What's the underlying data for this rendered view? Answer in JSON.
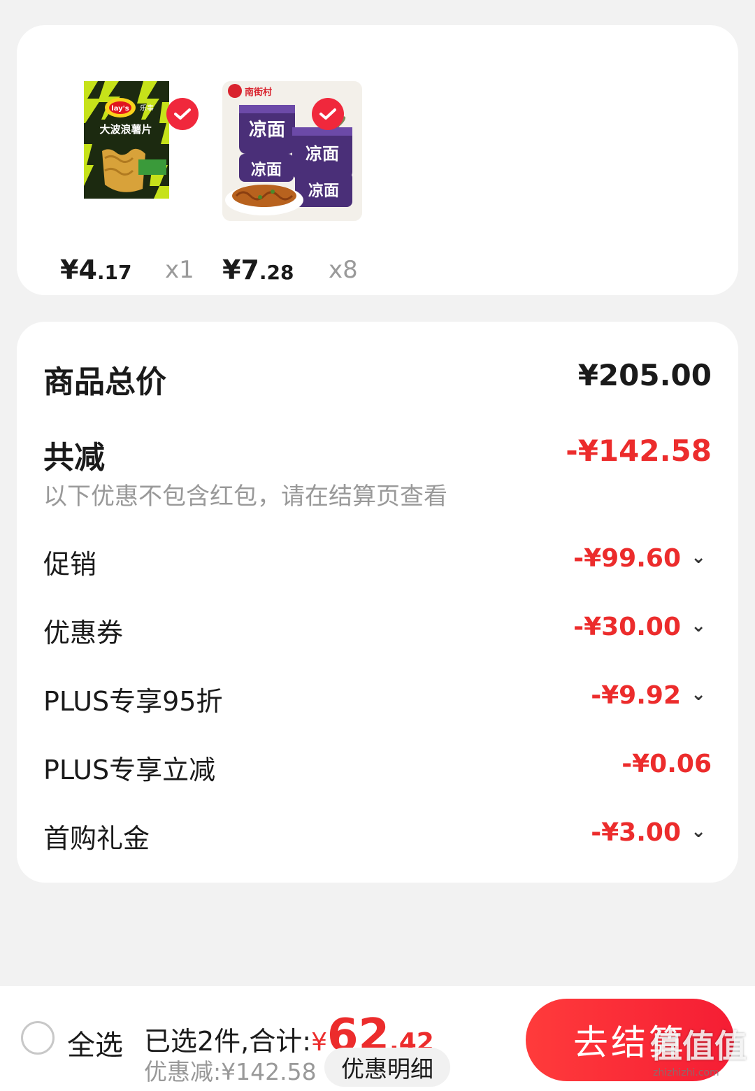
{
  "products": [
    {
      "brand_text": "Lay's乐事",
      "name_text": "大波浪薯片",
      "price_int": "¥4",
      "price_dec": ".17",
      "qty": "x1",
      "selected": true
    },
    {
      "brand_text": "南街村",
      "name_text": "凉面",
      "price_int": "¥7",
      "price_dec": ".28",
      "qty": "x8",
      "selected": true
    }
  ],
  "summary": {
    "total_label": "商品总价",
    "total_value": "¥205.00",
    "reduce_label": "共减",
    "reduce_value": "-¥142.58",
    "note": "以下优惠不包含红包，请在结算页查看",
    "rows": [
      {
        "label": "促销",
        "value": "-¥99.60",
        "expandable": true
      },
      {
        "label": "优惠券",
        "value": "-¥30.00",
        "expandable": true
      },
      {
        "label": "PLUS专享95折",
        "value": "-¥9.92",
        "expandable": true
      },
      {
        "label": "PLUS专享立减",
        "value": "-¥0.06",
        "expandable": false
      },
      {
        "label": "首购礼金",
        "value": "-¥3.00",
        "expandable": true
      }
    ]
  },
  "bottom_bar": {
    "select_all": "全选",
    "selected_text": "已选2件,合计:",
    "total_symbol": "¥",
    "total_int": "62",
    "total_dec": ".42",
    "discount_text": "优惠减:¥142.58",
    "detail_button": "优惠明细",
    "checkout_button": "去结算"
  },
  "watermark": {
    "big": "值值值",
    "small": "zhizhizhi.com"
  },
  "colors": {
    "accent_red": "#ec2c2c",
    "background": "#f2f2f2"
  }
}
